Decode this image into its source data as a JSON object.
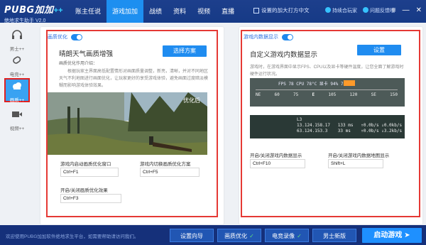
{
  "header": {
    "logo_main": "PUBG加加",
    "logo_plus": "++",
    "logo_sub": "绝地求生助手 V2.0",
    "nav": [
      "账主任说",
      "游戏加加",
      "战绩",
      "资料",
      "视频",
      "直播"
    ],
    "active_nav": "游戏加加",
    "checkbox_label": "设置的加大打方中文",
    "link1": "持续合玩家",
    "link2": "问题反馈哦",
    "controls": [
      "≡",
      "—",
      "✕"
    ]
  },
  "sidebar": {
    "items": [
      {
        "label": "男士++",
        "icon": "headset-icon"
      },
      {
        "label": "电竞++",
        "icon": "pill-icon"
      },
      {
        "label": "画质++",
        "icon": "cloud-icon"
      },
      {
        "label": "视频++",
        "icon": "video-icon"
      }
    ],
    "active": "画质++"
  },
  "left_panel": {
    "toggle_label": "画质优化",
    "title": "晴朗天气画质增强",
    "action_button": "选择方案",
    "intro_heading": "画质优化作用介绍：",
    "intro_text": "根据玩家主界面高低配置情形对画面质量调整，新亮，清晰，并对不同地区天气不利地图进行画面优化，让玩家更好的享受游戏体验，避免画面过度暗淡模糊而影响游戏体验效果。",
    "image_tag": "优化后",
    "fields": [
      {
        "label": "游戏内启动画质优化窗口",
        "value": "Ctrl+F1"
      },
      {
        "label": "游戏内切换画质优化方案",
        "value": "Ctrl+F5"
      },
      {
        "label": "开启/关闭画质优化效果",
        "value": "Ctrl+F3"
      }
    ]
  },
  "right_panel": {
    "toggle_label": "游戏内数据显示",
    "title": "自定义游戏内数据显示",
    "action_button": "设置",
    "desc": "游戏时，在游戏界面中显示FPS、CPU以及显卡等硬件温度，让您全面了解游戏时硬件运行状况。",
    "hud_line1": "FPS 78  CPU 78°C  显卡 94%  78°C",
    "compass": [
      "NE",
      "60",
      "75",
      "E",
      "105",
      "120",
      "SE",
      "150"
    ],
    "hud_line2": "L3\n13.124.158.17   133 ms   ↑0.0b/s ↓0.0kb/s\n63.124.153.3    33 ms    ↑0.0b/s ↓3.2kb/s",
    "fields": [
      {
        "label": "开启/关闭游戏内数据显示",
        "value": "Ctrl+F10"
      },
      {
        "label": "开启/关闭游戏内数据地图显示",
        "value": "Shift+L"
      }
    ]
  },
  "bottom": {
    "note": "欢迎使用PUBG加加软件绝地求生平台，如需要帮助请访问我们。",
    "buttons": [
      "设置向导",
      "画质优化",
      "电竞录像",
      "男士新版"
    ],
    "checked": [
      false,
      true,
      true,
      false
    ],
    "start": "启动游戏"
  },
  "colors": {
    "header_bg": "#163a86",
    "accent": "#1f8cf0",
    "highlight": "#e53935"
  }
}
